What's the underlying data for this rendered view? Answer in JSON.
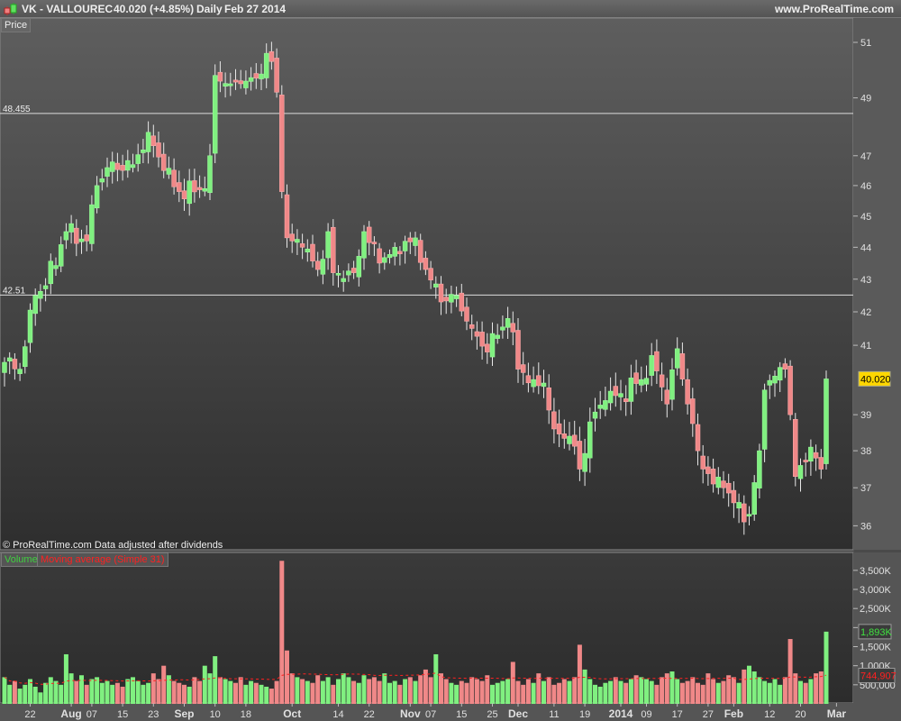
{
  "header": {
    "symbol": "VK - VALLOUREC",
    "quote": "40.020 (+4.85%)",
    "period": "Daily",
    "date": "Feb 27 2014",
    "site": "www.ProRealTime.com"
  },
  "price_pane": {
    "tab": "Price",
    "copyright": "© ProRealTime.com  Data adjusted after dividends",
    "last_label": "40.020",
    "last_color": "#ffd700"
  },
  "volume_pane": {
    "tab_volume": "Volume",
    "tab_ma": "Moving average (Simple 31)",
    "last_volume_label": "1,893K",
    "ma_label": "744,907"
  },
  "colors": {
    "up": "#80f080",
    "down": "#f08888",
    "wick": "#e8e8e8",
    "ma": "#ff2020",
    "hline": "#dddddd"
  },
  "chart_data": [
    {
      "type": "candlestick",
      "title": "VK - VALLOUREC",
      "scale": "log",
      "ylim": [
        35.6,
        51.6
      ],
      "yticks": [
        {
          "v": 51,
          "label": "51"
        },
        {
          "v": 49,
          "label": "49"
        },
        {
          "v": 47,
          "label": "47"
        },
        {
          "v": 46,
          "label": "46"
        },
        {
          "v": 45,
          "label": "45"
        },
        {
          "v": 44,
          "label": "44"
        },
        {
          "v": 43,
          "label": "43"
        },
        {
          "v": 42,
          "label": "42"
        },
        {
          "v": 41,
          "label": "41"
        },
        {
          "v": 39,
          "label": "39"
        },
        {
          "v": 38,
          "label": "38"
        },
        {
          "v": 37,
          "label": "37"
        },
        {
          "v": 36,
          "label": "36"
        }
      ],
      "hlines": [
        {
          "v": 48.455,
          "label": "48.455"
        },
        {
          "v": 42.51,
          "label": "42.51"
        }
      ],
      "n_bars": 161,
      "close_path": [
        [
          0,
          40.5
        ],
        [
          3,
          40.3
        ],
        [
          6,
          42.5
        ],
        [
          8,
          42.8
        ],
        [
          12,
          44.5
        ],
        [
          16,
          44.2
        ],
        [
          18,
          46
        ],
        [
          20,
          46.6
        ],
        [
          25,
          46.7
        ],
        [
          28,
          47.8
        ],
        [
          31,
          46.5
        ],
        [
          34,
          45.8
        ],
        [
          39,
          45.9
        ],
        [
          40,
          47
        ],
        [
          41,
          49.8
        ],
        [
          44,
          49.5
        ],
        [
          46,
          49.5
        ],
        [
          49,
          49.7
        ],
        [
          51,
          50.6
        ],
        [
          52,
          50.3
        ],
        [
          53,
          49.2
        ],
        [
          54,
          45.8
        ],
        [
          55,
          44.3
        ],
        [
          58,
          44
        ],
        [
          61,
          43.3
        ],
        [
          63,
          44.5
        ],
        [
          64,
          43.2
        ],
        [
          68,
          43.2
        ],
        [
          70,
          44.5
        ],
        [
          73,
          43.5
        ],
        [
          76,
          44
        ],
        [
          80,
          44.3
        ],
        [
          82,
          43.3
        ],
        [
          85,
          42.3
        ],
        [
          88,
          42.5
        ],
        [
          91,
          41.5
        ],
        [
          94,
          40.8
        ],
        [
          96,
          41.3
        ],
        [
          98,
          41.8
        ],
        [
          100,
          40.3
        ],
        [
          103,
          40
        ],
        [
          105,
          39.9
        ],
        [
          107,
          38.6
        ],
        [
          110,
          38.4
        ],
        [
          112,
          37.5
        ],
        [
          114,
          38.8
        ],
        [
          117,
          39.4
        ],
        [
          120,
          39.6
        ],
        [
          124,
          40
        ],
        [
          126,
          40.7
        ],
        [
          129,
          39.3
        ],
        [
          131,
          40.9
        ],
        [
          133,
          39.3
        ],
        [
          135,
          38
        ],
        [
          138,
          37.1
        ],
        [
          140,
          37
        ],
        [
          142,
          36.6
        ],
        [
          144,
          36.1
        ],
        [
          145,
          36.3
        ],
        [
          147,
          38
        ],
        [
          148,
          39.7
        ],
        [
          150,
          40.1
        ],
        [
          152,
          40.3
        ],
        [
          153,
          39
        ],
        [
          154,
          37.3
        ],
        [
          155,
          37.6
        ],
        [
          157,
          38.1
        ],
        [
          158,
          37.8
        ],
        [
          159,
          37.5
        ],
        [
          160,
          40.02
        ]
      ],
      "last": 40.02
    },
    {
      "type": "bar",
      "title": "Volume",
      "ylim": [
        0,
        3900
      ],
      "unit": "K",
      "yticks": [
        {
          "v": 3500,
          "label": "3,500K"
        },
        {
          "v": 3000,
          "label": "3,000K"
        },
        {
          "v": 2500,
          "label": "2,500K"
        },
        {
          "v": 2000,
          "label": "2,000K"
        },
        {
          "v": 1500,
          "label": "1,500K"
        },
        {
          "v": 1000,
          "label": "1,000K"
        },
        {
          "v": 500,
          "label": "500,000"
        }
      ],
      "values": [
        700,
        500,
        600,
        400,
        500,
        650,
        450,
        300,
        550,
        700,
        600,
        500,
        1300,
        800,
        600,
        750,
        500,
        650,
        700,
        550,
        600,
        500,
        550,
        450,
        650,
        700,
        600,
        500,
        550,
        800,
        650,
        1000,
        750,
        600,
        550,
        500,
        450,
        700,
        600,
        1000,
        800,
        1250,
        700,
        650,
        600,
        550,
        700,
        500,
        600,
        550,
        500,
        450,
        400,
        600,
        3750,
        1400,
        800,
        700,
        650,
        600,
        550,
        750,
        600,
        700,
        500,
        650,
        800,
        700,
        600,
        550,
        750,
        650,
        700,
        600,
        800,
        550,
        600,
        500,
        650,
        700,
        600,
        750,
        900,
        700,
        1300,
        800,
        650,
        550,
        500,
        600,
        550,
        700,
        650,
        600,
        750,
        500,
        550,
        600,
        650,
        1100,
        600,
        500,
        650,
        550,
        800,
        600,
        700,
        500,
        550,
        650,
        600,
        700,
        1550,
        900,
        650,
        500,
        450,
        550,
        600,
        700,
        600,
        550,
        650,
        750,
        700,
        650,
        600,
        500,
        700,
        800,
        850,
        650,
        550,
        600,
        700,
        550,
        500,
        800,
        650,
        550,
        600,
        750,
        700,
        550,
        900,
        1000,
        850,
        700,
        600,
        550,
        650,
        500,
        700,
        1700,
        800,
        600,
        550,
        650,
        800,
        850,
        1893
      ],
      "moving_average": {
        "period": 31,
        "last": 744.907
      }
    },
    {
      "type": "axis",
      "xticks": [
        {
          "i": 5,
          "label": "22"
        },
        {
          "i": 13,
          "label": "Aug"
        },
        {
          "i": 17,
          "label": "07"
        },
        {
          "i": 23,
          "label": "15"
        },
        {
          "i": 29,
          "label": "23"
        },
        {
          "i": 35,
          "label": "Sep"
        },
        {
          "i": 41,
          "label": "10"
        },
        {
          "i": 47,
          "label": "18"
        },
        {
          "i": 56,
          "label": "Oct"
        },
        {
          "i": 65,
          "label": "14"
        },
        {
          "i": 71,
          "label": "22"
        },
        {
          "i": 79,
          "label": "Nov"
        },
        {
          "i": 83,
          "label": "07"
        },
        {
          "i": 89,
          "label": "15"
        },
        {
          "i": 95,
          "label": "25"
        },
        {
          "i": 100,
          "label": "Dec"
        },
        {
          "i": 107,
          "label": "11"
        },
        {
          "i": 113,
          "label": "19"
        },
        {
          "i": 120,
          "label": "2014"
        },
        {
          "i": 125,
          "label": "09"
        },
        {
          "i": 131,
          "label": "17"
        },
        {
          "i": 137,
          "label": "27"
        },
        {
          "i": 142,
          "label": "Feb"
        },
        {
          "i": 149,
          "label": "12"
        },
        {
          "i": 155,
          "label": "20"
        },
        {
          "i": 162,
          "label": "Mar"
        }
      ]
    }
  ]
}
